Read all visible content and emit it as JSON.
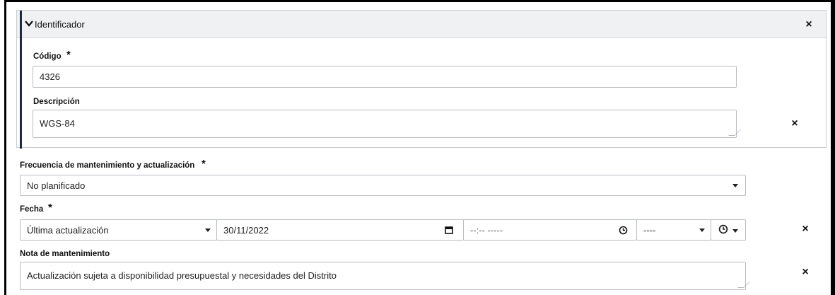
{
  "section": {
    "title": "Identificador",
    "codigo_label": "Código",
    "codigo_value": "4326",
    "descripcion_label": "Descripción",
    "descripcion_value": "WGS-84",
    "close_icon": "×"
  },
  "required_mark": "*",
  "frecuencia": {
    "label": "Frecuencia de mantenimiento y actualización",
    "selected": "No planificado"
  },
  "fecha": {
    "label": "Fecha",
    "type_selected": "Última actualización",
    "date_value": "30/11/2022",
    "time_value": "--:-- -----",
    "zone_selected": "----"
  },
  "nota": {
    "label": "Nota de mantenimiento",
    "value": "Actualización sujeta a disponibilidad presupuestal y necesidades del Distrito"
  },
  "icons": {
    "chevron": "chevron-down-icon",
    "close": "close-icon",
    "calendar": "calendar-icon",
    "clock": "clock-icon"
  },
  "colors": {
    "panel_bar": "#f0f1f3",
    "accent": "#1e2a44",
    "border": "#b9bdc3"
  }
}
